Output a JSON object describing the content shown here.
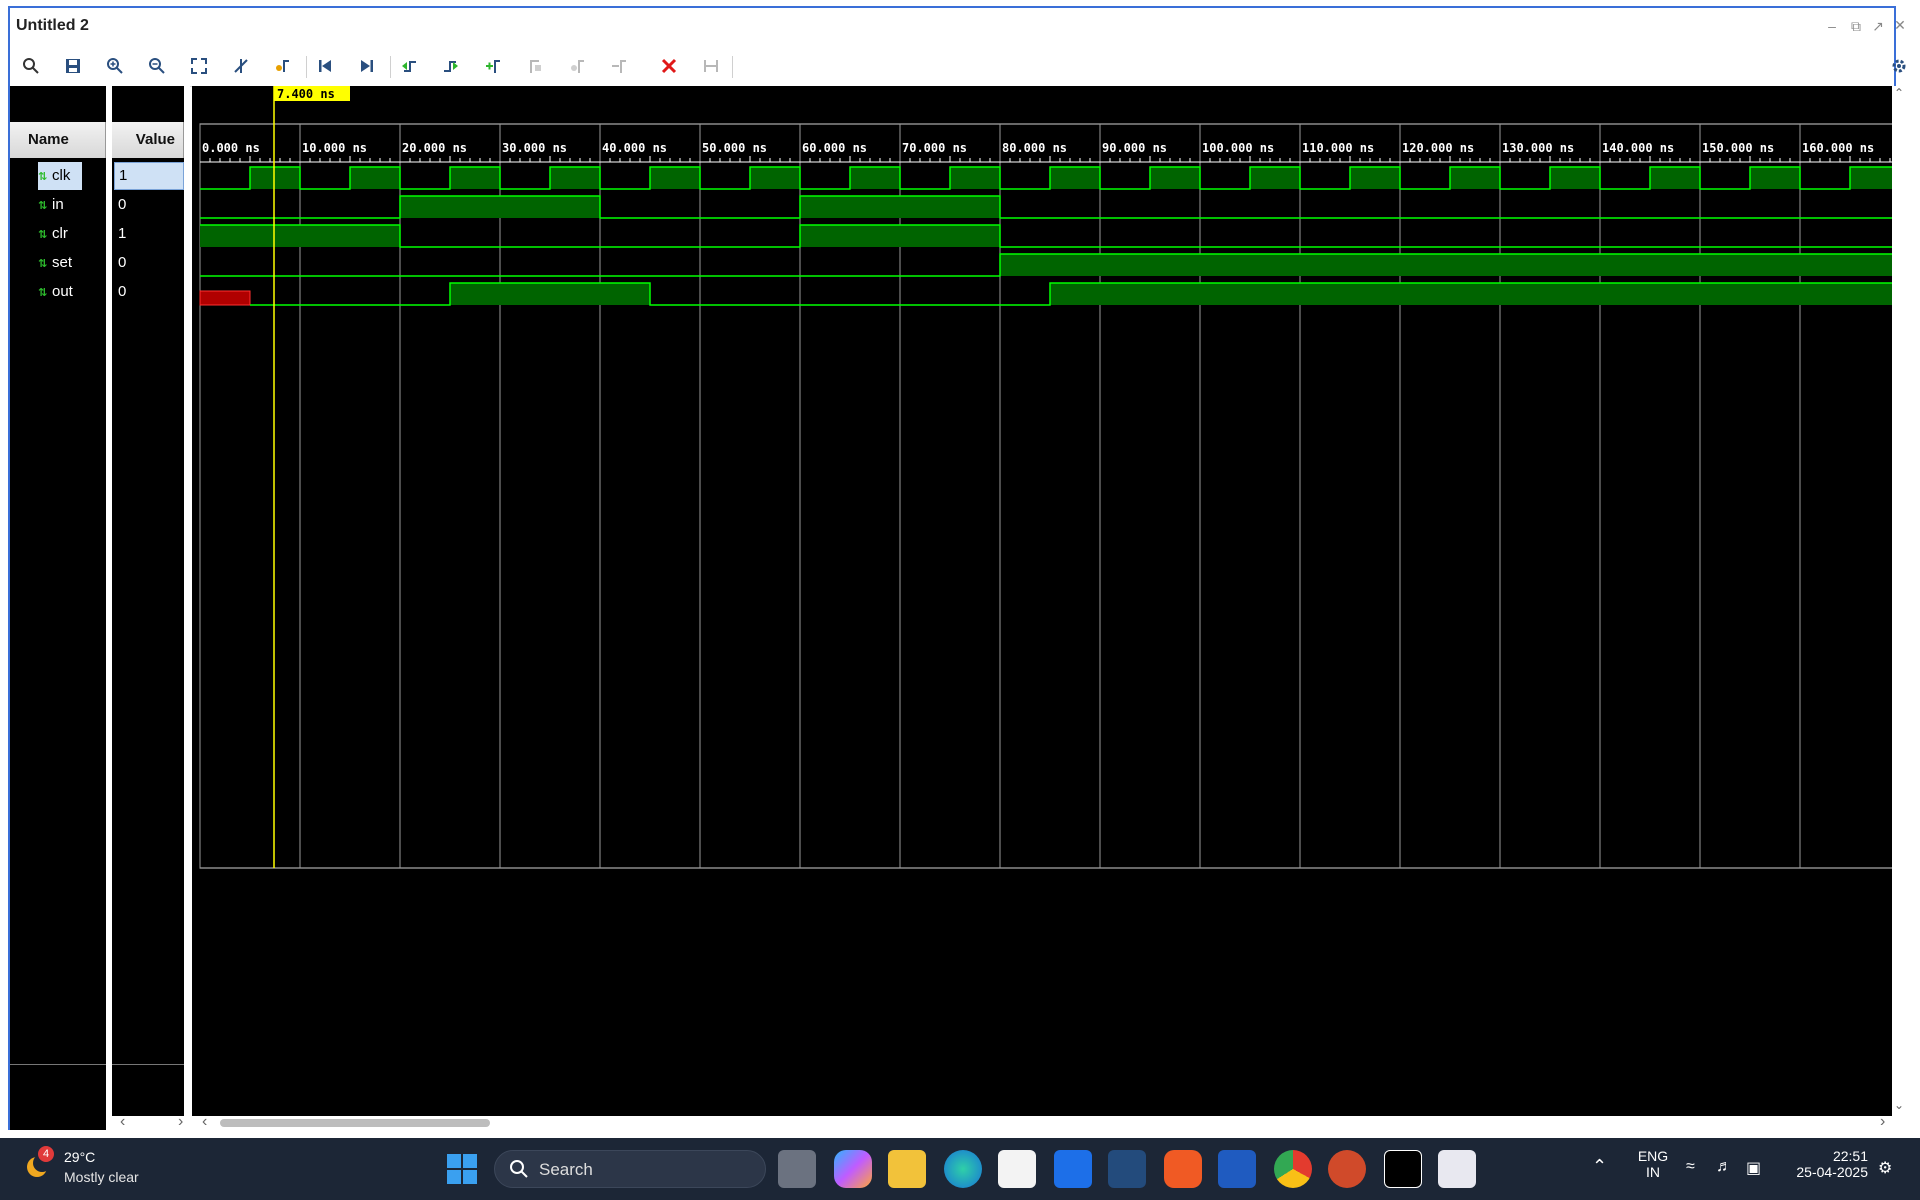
{
  "window": {
    "title": "Untitled 2"
  },
  "toolbar": {
    "icons": [
      "search-icon",
      "save-icon",
      "zoom-in-icon",
      "zoom-out-icon",
      "zoom-fit-icon",
      "toggle-cursor-icon",
      "go-to-cursor-icon",
      "go-to-time-zero-icon",
      "go-to-last-time-icon",
      "previous-transition-icon",
      "next-transition-icon",
      "add-marker-icon",
      "previous-marker-icon",
      "next-marker-icon",
      "swap-cursors-icon",
      "delete-icon",
      "snap-icon"
    ],
    "settings_icon": "gear-icon"
  },
  "panels": {
    "name_header": "Name",
    "value_header": "Value"
  },
  "signals": [
    {
      "name": "clk",
      "value": "1"
    },
    {
      "name": "in",
      "value": "0"
    },
    {
      "name": "clr",
      "value": "1"
    },
    {
      "name": "set",
      "value": "0"
    },
    {
      "name": "out",
      "value": "0"
    }
  ],
  "cursor": {
    "time_ns": 7.4,
    "label": "7.400 ns"
  },
  "timeline": {
    "ticks": [
      "0.000 ns",
      "10.000 ns",
      "20.000 ns",
      "30.000 ns",
      "40.000 ns",
      "50.000 ns",
      "60.000 ns",
      "70.000 ns",
      "80.000 ns",
      "90.000 ns",
      "100.000 ns",
      "110.000 ns",
      "120.000 ns",
      "130.000 ns",
      "140.000 ns",
      "150.000 ns",
      "160.000 ns"
    ],
    "range_ns": [
      0,
      170
    ]
  },
  "waveforms": {
    "clk": {
      "type": "clock",
      "period_ns": 10,
      "high_start_ns": 5
    },
    "in": {
      "high_intervals_ns": [
        [
          20,
          40
        ],
        [
          60,
          80
        ]
      ]
    },
    "clr": {
      "high_intervals_ns": [
        [
          0,
          20
        ],
        [
          60,
          80
        ]
      ]
    },
    "set": {
      "high_intervals_ns": [
        [
          80,
          170
        ]
      ]
    },
    "out": {
      "unknown_intervals_ns": [
        [
          0,
          5
        ]
      ],
      "high_intervals_ns": [
        [
          25,
          45
        ],
        [
          85,
          170
        ]
      ]
    }
  },
  "colors": {
    "wave": "#00ff00",
    "wave_fill": "#006400",
    "cursor": "#ffff00",
    "unknown": "#b00000",
    "grid": "#9a9a9a"
  },
  "taskbar": {
    "weather_temp": "29°C",
    "weather_desc": "Mostly clear",
    "weather_badge": "4",
    "search_placeholder": "Search",
    "lang_line1": "ENG",
    "lang_line2": "IN",
    "time": "22:51",
    "date": "25-04-2025",
    "apps": [
      "windows-start-icon",
      "task-view-icon",
      "copilot-icon",
      "file-explorer-icon",
      "edge-icon",
      "store-icon",
      "dropbox-icon",
      "defender-icon",
      "brave-icon",
      "word-icon",
      "chrome-icon",
      "powerpoint-icon",
      "vivado-icon",
      "snipping-tool-icon"
    ]
  }
}
